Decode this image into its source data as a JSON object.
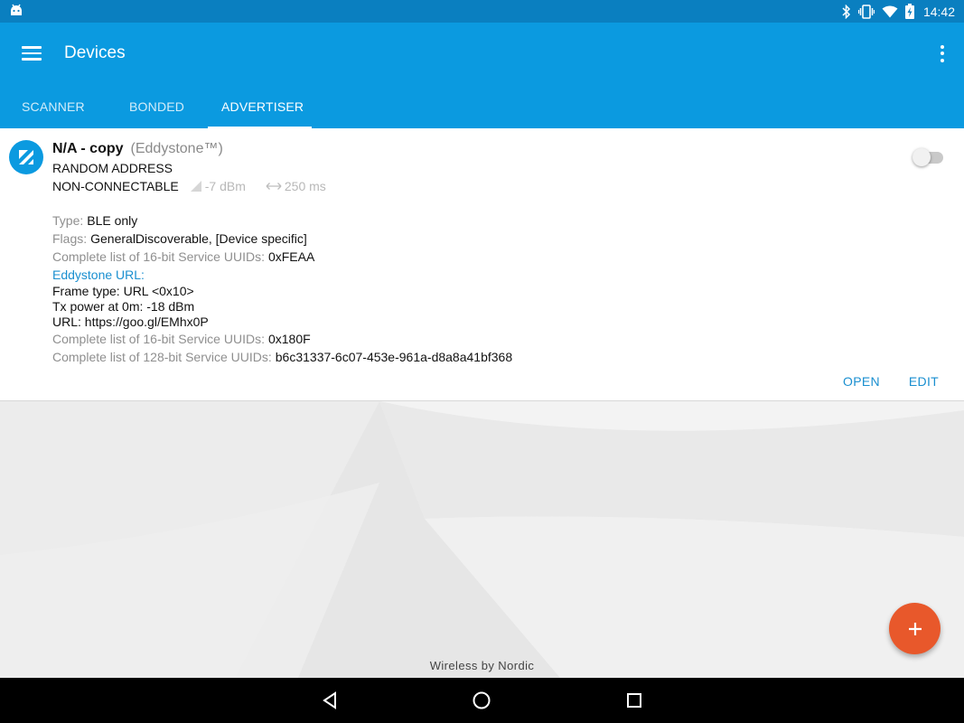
{
  "status_bar": {
    "time": "14:42",
    "icons": [
      "android-debug-icon",
      "bluetooth-icon",
      "vibrate-icon",
      "wifi-icon",
      "battery-charging-icon"
    ]
  },
  "app_bar": {
    "title": "Devices",
    "tabs": [
      {
        "label": "SCANNER",
        "active": false
      },
      {
        "label": "BONDED",
        "active": false
      },
      {
        "label": "ADVERTISER",
        "active": true
      }
    ]
  },
  "device": {
    "name": "N/A - copy",
    "type": "(Eddystone™)",
    "address": "RANDOM ADDRESS",
    "connectable": "NON-CONNECTABLE",
    "tx_power": "-7 dBm",
    "interval": "250 ms",
    "enabled": false,
    "details": {
      "type_label": "Type:",
      "type_value": "BLE only",
      "flags_label": "Flags:",
      "flags_value": "GeneralDiscoverable, [Device specific]",
      "uuid16_label": "Complete list of 16-bit Service UUIDs:",
      "uuid16_value": "0xFEAA",
      "eddystone_head": "Eddystone URL:",
      "frame_type": "Frame type: URL <0x10>",
      "tx_power_0m": "Tx power at 0m: -18 dBm",
      "url": "URL: https://goo.gl/EMhx0P",
      "uuid16b_label": "Complete list of 16-bit Service UUIDs:",
      "uuid16b_value": "0x180F",
      "uuid128_label": "Complete list of 128-bit Service UUIDs:",
      "uuid128_value": "b6c31337-6c07-453e-961a-d8a8a41bf368"
    },
    "actions": {
      "open": "OPEN",
      "edit": "EDIT"
    }
  },
  "footer": {
    "text": "Wireless by Nordic"
  },
  "colors": {
    "app_bar": "#0b9ae0",
    "status_bar": "#0a7fc0",
    "accent": "#1a8fd0",
    "fab": "#e8582b"
  }
}
